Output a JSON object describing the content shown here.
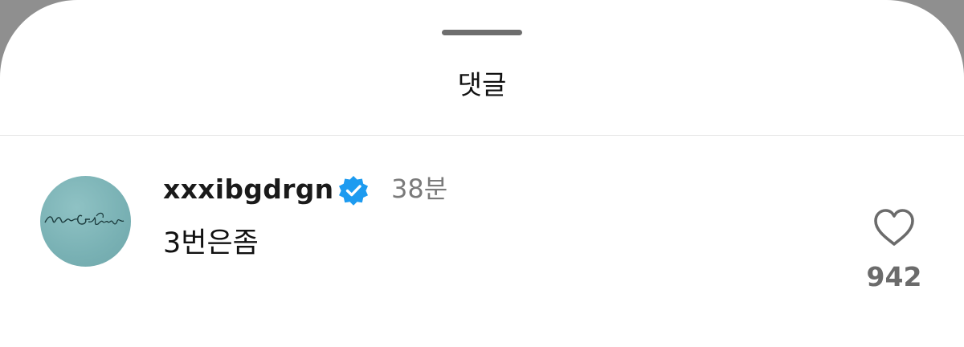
{
  "sheet": {
    "title": "댓글"
  },
  "comment": {
    "username": "xxxibgdrgn",
    "verified": true,
    "timestamp": "38분",
    "text": "3번은좀",
    "like_count": "942",
    "avatar_icon": "signature-avatar"
  },
  "colors": {
    "verified_badge": "#1d9bf0",
    "avatar_bg": "#7fb6b8"
  }
}
